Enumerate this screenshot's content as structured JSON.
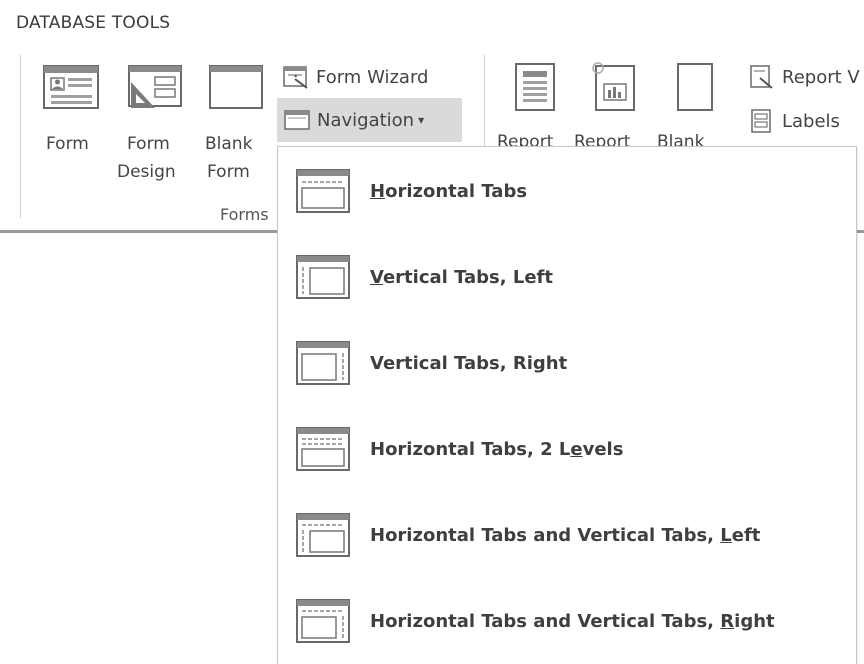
{
  "ribbon_tab": "DATABASE TOOLS",
  "forms_group": {
    "form_label": "Form",
    "form_design_label_1": "Form",
    "form_design_label_2": "Design",
    "blank_form_label_1": "Blank",
    "blank_form_label_2": "Form",
    "form_wizard_label": "Form Wizard",
    "navigation_label": "Navigation",
    "navigation_caret": "▾",
    "group_title": "Forms"
  },
  "reports_group": {
    "report_label": "Report",
    "report_design_label": "Report",
    "blank_report_label": "Blank",
    "report_wizard_label": "Report V",
    "labels_label": "Labels"
  },
  "navigation_menu": {
    "items": [
      {
        "pre": "",
        "key": "H",
        "post": "orizontal Tabs"
      },
      {
        "pre": "",
        "key": "V",
        "post": "ertical Tabs, Left"
      },
      {
        "pre": "Vertical Tabs, Right",
        "key": "",
        "post": ""
      },
      {
        "pre": "Horizontal Tabs, 2 L",
        "key": "e",
        "post": "vels"
      },
      {
        "pre": "Horizontal Tabs and Vertical Tabs, ",
        "key": "L",
        "post": "eft"
      },
      {
        "pre": "Horizontal Tabs and Vertical Tabs, ",
        "key": "R",
        "post": "ight"
      }
    ]
  }
}
